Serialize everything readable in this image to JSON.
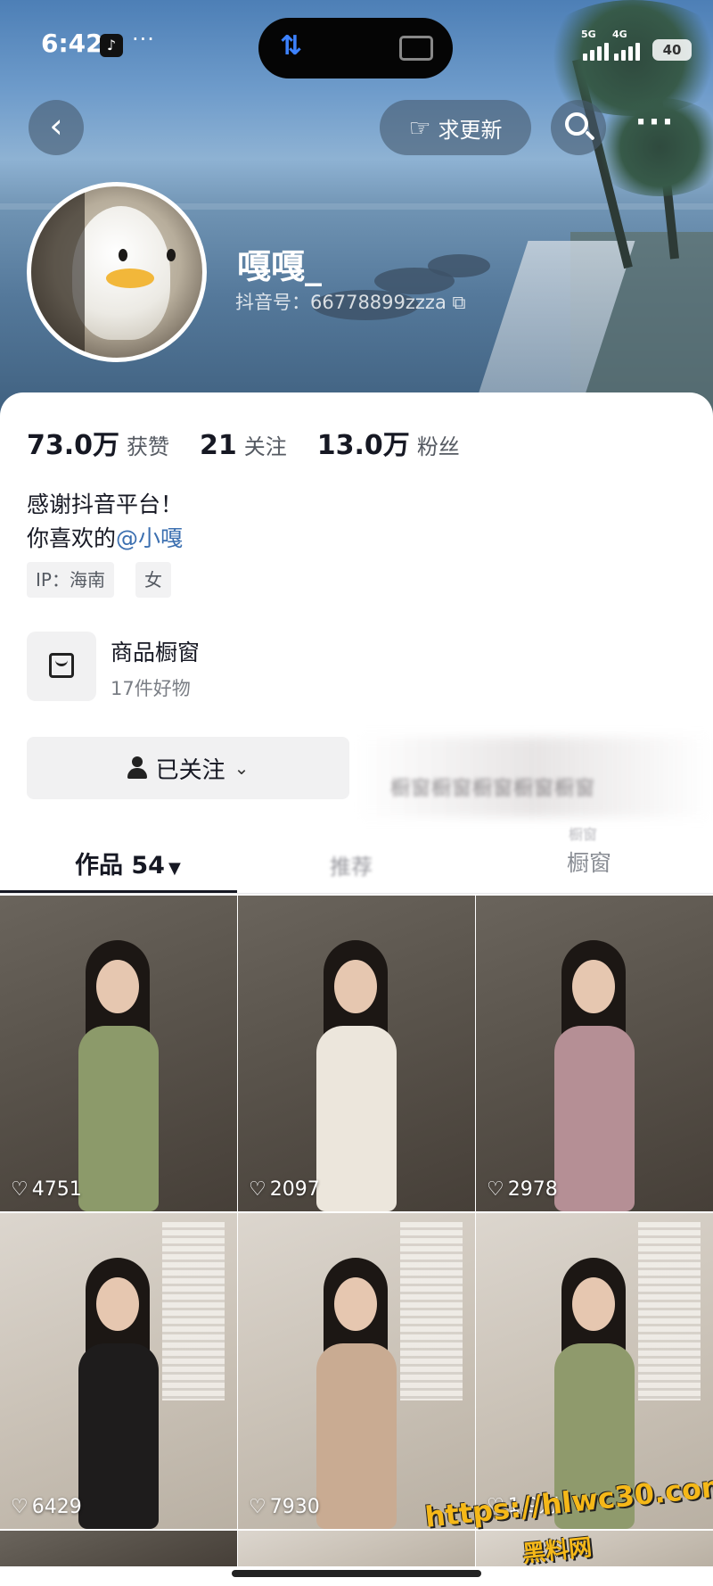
{
  "status_bar": {
    "time": "6:42",
    "dots": "···",
    "network1": "5G",
    "network2": "4G",
    "battery": "40",
    "island_icon": "⇅"
  },
  "nav": {
    "back": "‹",
    "update_label": "求更新",
    "more": "···"
  },
  "profile": {
    "username": "嘎嘎_",
    "douyin_id": "抖音号：66778899zzza ⧉"
  },
  "stats": [
    {
      "num": "73.0万",
      "label": "获赞"
    },
    {
      "num": "21",
      "label": "关注"
    },
    {
      "num": "13.0万",
      "label": "粉丝"
    }
  ],
  "bio": {
    "line1": "感谢抖音平台！",
    "line2_prefix": "你喜欢的",
    "mention": "@小嘎"
  },
  "tags": [
    "IP：海南",
    "女"
  ],
  "shop": {
    "title": "商品橱窗",
    "subtitle": "17件好物"
  },
  "follow": {
    "label": "已关注",
    "chevron": "⌄"
  },
  "blurred_text": "橱窗橱窗橱窗橱窗橱窗",
  "tabs": {
    "works": "作品 54",
    "caret": "▼",
    "middle": "推荐",
    "window": "橱窗",
    "window_ghost": "橱窗"
  },
  "videos": [
    {
      "likes": "4751",
      "bg": "dark",
      "outfit": "#8c9a6a"
    },
    {
      "likes": "2097",
      "bg": "dark",
      "outfit": "#ece6dc"
    },
    {
      "likes": "2978",
      "bg": "dark",
      "outfit": "#b58f95"
    },
    {
      "likes": "6429",
      "bg": "light",
      "outfit": "#1e1c1c"
    },
    {
      "likes": "7930",
      "bg": "light",
      "outfit": "#c9ab92"
    },
    {
      "likes": "1.9万",
      "bg": "light",
      "outfit": "#8f9a6c"
    }
  ],
  "watermark": {
    "url": "https://hlwc30.com",
    "name": "黑料网"
  },
  "colors": {
    "mention": "#3b6fb0",
    "watermark": "#f5b818"
  }
}
